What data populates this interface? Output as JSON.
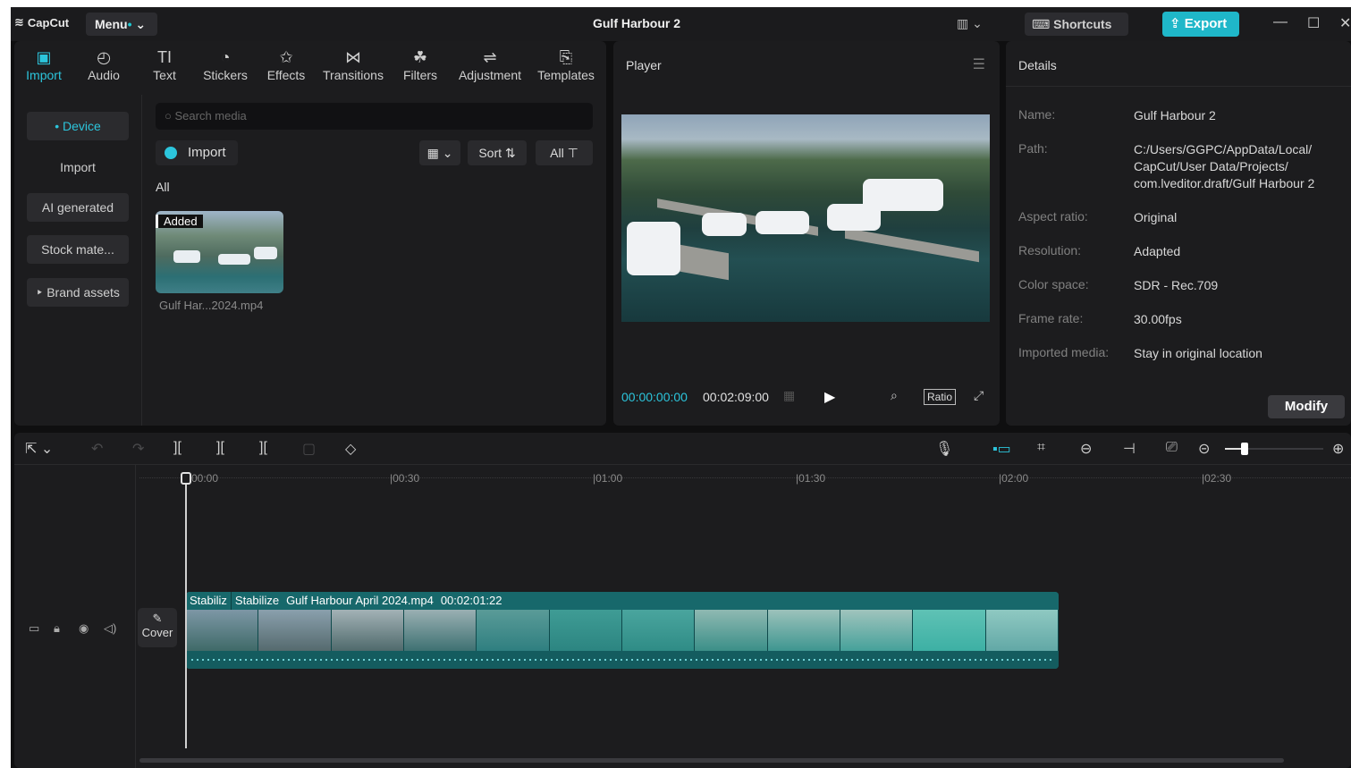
{
  "app": {
    "brand": "CapCut",
    "menu_label": "Menu",
    "menu_dot": "•",
    "title": "Gulf Harbour 2",
    "shortcuts_label": "Shortcuts",
    "export_label": "Export",
    "accent_color": "#2cc5dc",
    "export_color": "#1fb7c9"
  },
  "toolbar": {
    "tabs": [
      {
        "label": "Import",
        "icon": "import-icon"
      },
      {
        "label": "Audio",
        "icon": "audio-icon"
      },
      {
        "label": "Text",
        "icon": "text-icon"
      },
      {
        "label": "Stickers",
        "icon": "stickers-icon"
      },
      {
        "label": "Effects",
        "icon": "effects-icon"
      },
      {
        "label": "Transitions",
        "icon": "transitions-icon"
      },
      {
        "label": "Filters",
        "icon": "filters-icon"
      },
      {
        "label": "Adjustment",
        "icon": "adjustment-icon"
      },
      {
        "label": "Templates",
        "icon": "templates-icon"
      }
    ],
    "active": "Import"
  },
  "sidebar": {
    "items": [
      {
        "label": "Device"
      },
      {
        "label": "Import"
      },
      {
        "label": "AI generated"
      },
      {
        "label": "Stock mate..."
      },
      {
        "label": "Brand assets"
      }
    ]
  },
  "media": {
    "search_placeholder": "Search media",
    "import_label": "Import",
    "sort_label": "Sort",
    "all_chip": "All",
    "filter_label": "All",
    "item": {
      "tag": "Added",
      "filename": "Gulf Har...2024.mp4"
    }
  },
  "player": {
    "title": "Player",
    "current_time": "00:00:00:00",
    "total_time": "00:02:09:00",
    "ratio_label": "Ratio"
  },
  "details": {
    "title": "Details",
    "rows": [
      {
        "key": "Name:",
        "value": "Gulf Harbour 2"
      },
      {
        "key": "Path:",
        "value": "C:/Users/GGPC/AppData/Local/ CapCut/User Data/Projects/ com.lveditor.draft/Gulf Harbour 2"
      },
      {
        "key": "Aspect ratio:",
        "value": "Original"
      },
      {
        "key": "Resolution:",
        "value": "Adapted"
      },
      {
        "key": "Color space:",
        "value": "SDR - Rec.709"
      },
      {
        "key": "Frame rate:",
        "value": "30.00fps"
      },
      {
        "key": "Imported media:",
        "value": "Stay in original location"
      }
    ],
    "modify_label": "Modify"
  },
  "timeline": {
    "ruler": [
      "00:00",
      "|00:30",
      "|01:00",
      "|01:30",
      "|02:00",
      "|02:30"
    ],
    "cover_label": "Cover",
    "clip": {
      "labels": [
        "Stabiliz",
        "Stabilize",
        "Gulf Harbour April 2024.mp4",
        "00:02:01:22"
      ]
    },
    "zoom_level": 0.2
  }
}
